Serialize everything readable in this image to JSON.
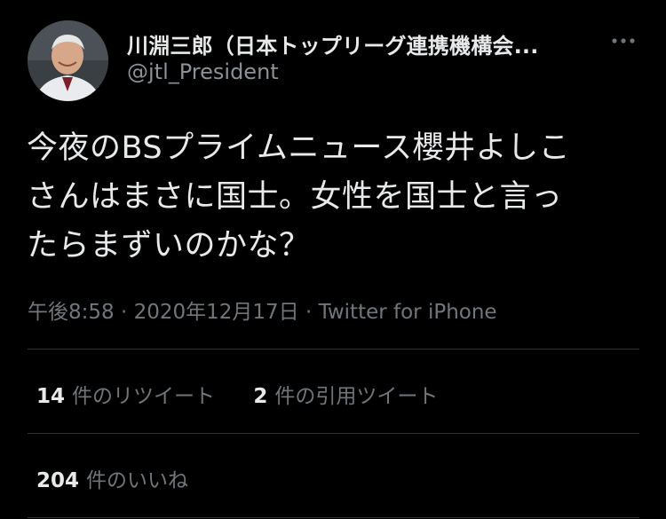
{
  "tweet": {
    "display_name": "川淵三郎（日本トップリーグ連携機構会...",
    "handle": "@jtl_President",
    "text_lines": [
      "今夜のBSプライムニュース櫻井よしこ",
      "さんはまさに国士。女性を国士と言っ",
      "たらまずいのかな？"
    ],
    "time": "午後8:58",
    "date": "2020年12月17日",
    "source": "Twitter for iPhone",
    "separator": "·"
  },
  "stats": {
    "retweets_count": "14",
    "retweets_label": "件のリツイート",
    "quotes_count": "2",
    "quotes_label": "件の引用ツイート",
    "likes_count": "204",
    "likes_label": "件のいいね"
  },
  "icons": {
    "more": "more-options-icon",
    "avatar": "profile-photo"
  },
  "colors": {
    "background": "#000000",
    "primary_text": "#e7e9ea",
    "secondary_text": "#71767b",
    "divider": "#2f3336"
  }
}
